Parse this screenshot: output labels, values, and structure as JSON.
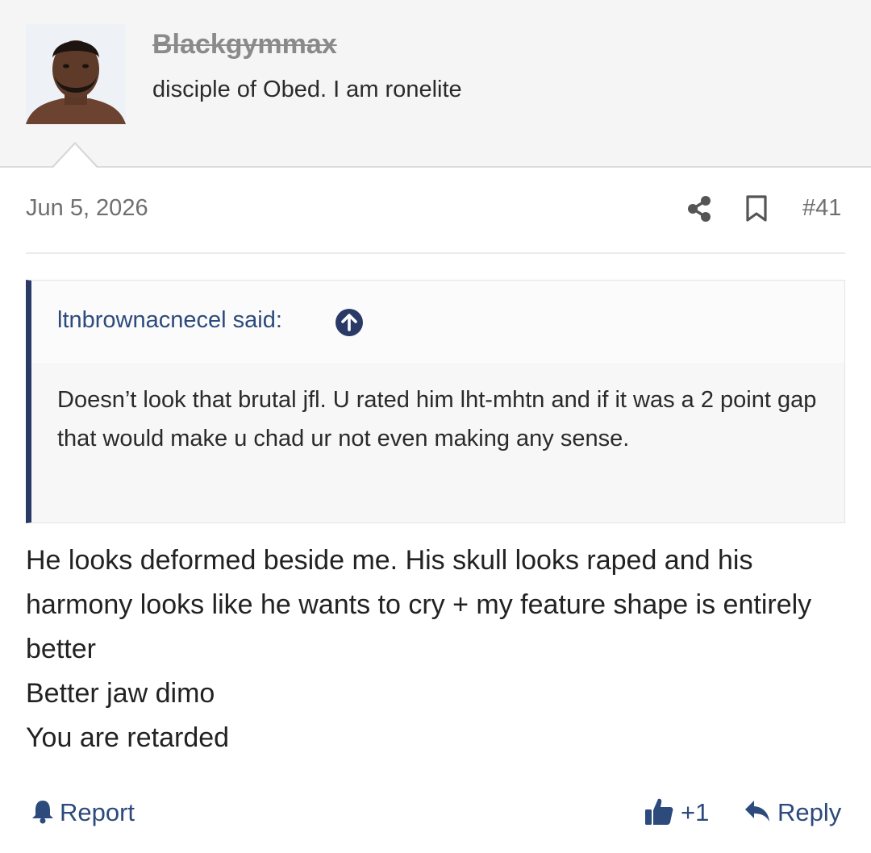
{
  "user": {
    "name": "Blackgymmax",
    "title": "disciple of Obed. I am ronelite"
  },
  "post": {
    "date": "Jun 5, 2026",
    "number": "#41",
    "quote": {
      "author": "ltnbrownacnecel said:",
      "text": "Doesn’t look that brutal jfl. U rated him lht-mhtn and if it was a 2 point gap that would make u chad ur not even making any sense."
    },
    "body": [
      "He looks deformed beside me. His skull looks raped and his harmony looks like he wants to cry + my feature shape is entirely better",
      "Better jaw dimo",
      "You are retarded"
    ],
    "actions": {
      "report": "Report",
      "like_count": "+1",
      "reply": "Reply"
    }
  },
  "colors": {
    "accent": "#2c4a7c",
    "quote_border": "#2a3a66",
    "header_bg": "#f5f5f5"
  },
  "icons": [
    "share-icon",
    "bookmark-icon",
    "arrow-up-circle-icon",
    "bell-icon",
    "thumbs-up-icon",
    "reply-arrow-icon"
  ]
}
